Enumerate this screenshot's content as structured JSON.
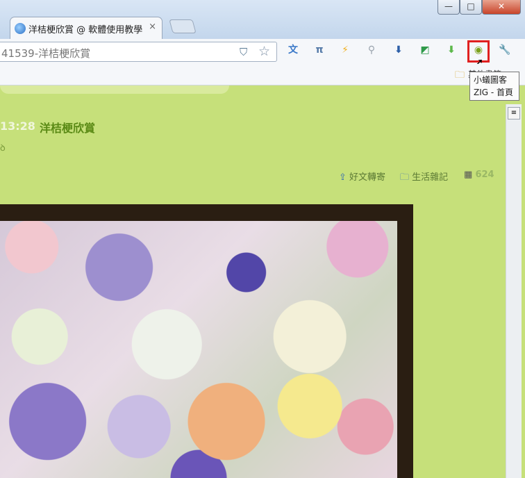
{
  "window": {
    "tab_title": "洋桔梗欣賞 @ 軟體使用教學",
    "tab_close": "×",
    "controls": {
      "minimize": "—",
      "maximize": "□",
      "close": "✕"
    }
  },
  "toolbar": {
    "url": "41539-洋桔梗欣賞",
    "extensions": [
      {
        "name": "translate-icon",
        "glyph": "文",
        "color": "#3a78c8"
      },
      {
        "name": "pi-icon",
        "glyph": "π",
        "color": "#557aa8"
      },
      {
        "name": "lightning-icon",
        "glyph": "⚡",
        "color": "#f0b020"
      },
      {
        "name": "search-icon",
        "glyph": "⚲",
        "color": "#9aa3ad"
      },
      {
        "name": "download-icon",
        "glyph": "⬇",
        "color": "#2d5fa8"
      },
      {
        "name": "color-picker-icon",
        "glyph": "◩",
        "color": "#2f9a4a"
      },
      {
        "name": "green-arrow-icon",
        "glyph": "⬇",
        "color": "#5cb84a"
      },
      {
        "name": "zig-icon",
        "glyph": "◉",
        "color": "#7aa21c"
      },
      {
        "name": "wrench-icon",
        "glyph": "🔧",
        "color": "#555555"
      }
    ]
  },
  "bookmarks": {
    "folder_label": "其他書籤"
  },
  "tooltip": {
    "line1": "小蟻圖客",
    "line2": "ZIG - 首頁"
  },
  "post": {
    "time": "13:28",
    "title": "洋桔梗欣賞",
    "sub": "ꝺ",
    "meta": {
      "share": "好文轉寄",
      "category": "生活雜記",
      "views": "624"
    }
  },
  "colors": {
    "page_bg": "#c6e07a",
    "title_green": "#5a8a15",
    "highlight": "#e02020"
  }
}
